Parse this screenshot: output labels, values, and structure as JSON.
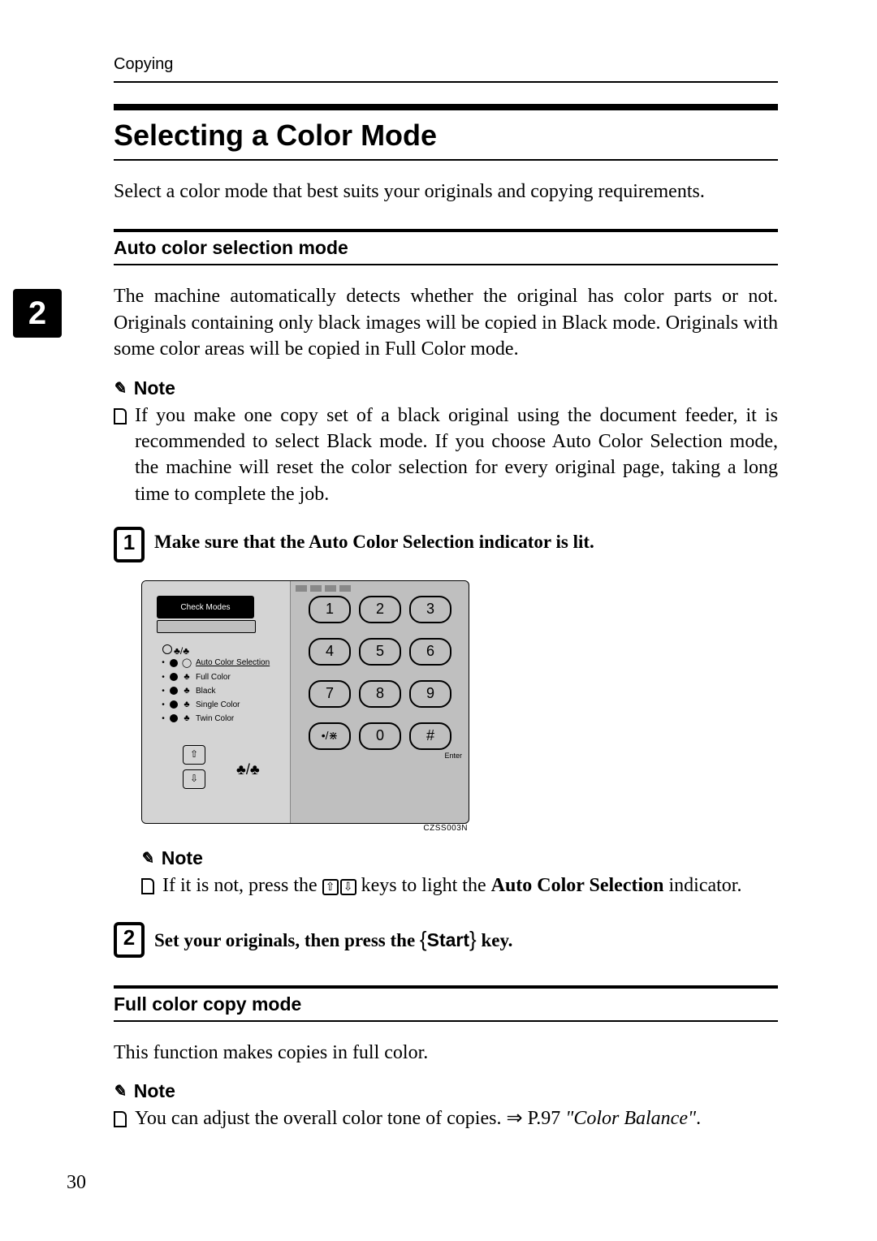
{
  "header": {
    "running": "Copying",
    "section_number": "2"
  },
  "page_number": "30",
  "title": "Selecting a Color Mode",
  "intro": "Select a color mode that best suits your originals and copying requirements.",
  "auto": {
    "heading": "Auto color selection mode",
    "para": "The machine automatically detects whether the original has color parts or not. Originals containing only black images will be copied in Black mode. Originals with some color areas will be copied in Full Color mode.",
    "note_label": "Note",
    "note_text": "If you make one copy set of a black original using the document feeder, it is recommended to select Black mode. If you choose Auto Color Selection mode, the machine will reset the color selection for every original page, taking a long time to complete the job.",
    "step1": "Make sure that the Auto Color Selection indicator is lit.",
    "panel": {
      "check_modes": "Check Modes",
      "modes": [
        "Auto Color Selection",
        "Full Color",
        "Black",
        "Single Color",
        "Twin Color"
      ],
      "keys": [
        "1",
        "2",
        "3",
        "4",
        "5",
        "6",
        "7",
        "8",
        "9",
        "•/⋇",
        "0",
        "#"
      ],
      "enter": "Enter",
      "code": "CZSS003N"
    },
    "note2_label": "Note",
    "note2_pre": "If it is not, press the ",
    "note2_post": " keys to light the ",
    "note2_bold": "Auto Color Selection",
    "note2_end": " indicator.",
    "step2_pre": "Set your originals, then press the ",
    "step2_key": "Start",
    "step2_post": " key."
  },
  "full": {
    "heading": "Full color copy mode",
    "para": "This function makes copies in full color.",
    "note_label": "Note",
    "note_pre": "You can adjust the overall color tone of copies. ",
    "note_arrow": "⇒",
    "note_ref_page": "P.97 ",
    "note_ref_title": "\"Color Balance\"",
    "note_end": "."
  }
}
